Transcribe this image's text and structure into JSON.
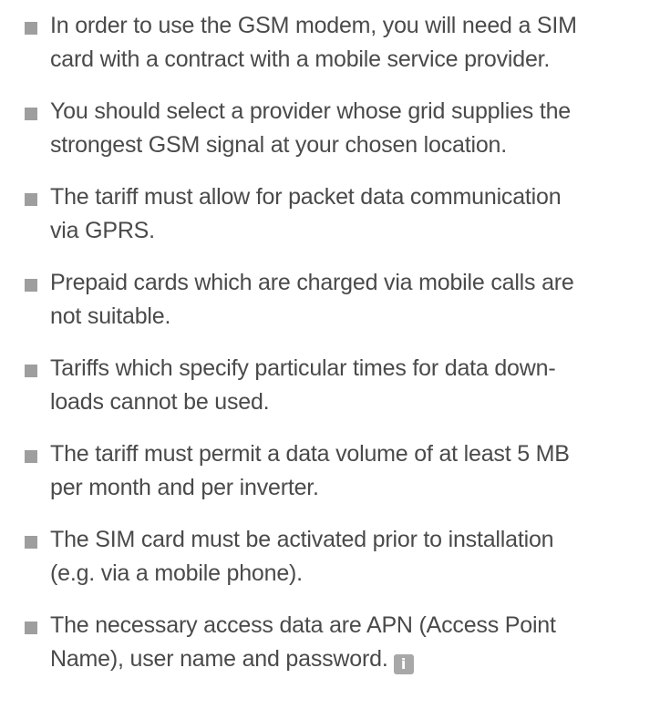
{
  "colors": {
    "bullet": "#9e9e9e",
    "text": "#4a4a4a",
    "info_icon_bg": "#a8a8a8"
  },
  "bullets": [
    {
      "text": "In order to use the GSM modem, you will need a SIM\ncard with a contract with a mobile service provider."
    },
    {
      "text": "You should select a provider whose grid supplies the\nstrongest GSM signal at your chosen location."
    },
    {
      "text": "The tariff must allow for packet data communication\nvia GPRS."
    },
    {
      "text": "Prepaid cards which are charged via mobile calls are\nnot suitable."
    },
    {
      "text": "Tariffs which specify particular times for data down-\nloads cannot be used."
    },
    {
      "text": "The tariff must permit a data volume of at least 5 MB\nper month and per inverter."
    },
    {
      "text": "The SIM card must be activated prior to installation\n(e.g. via a mobile phone)."
    },
    {
      "text": "The necessary access data are APN (Access Point\nName), user name and password."
    }
  ],
  "info_icon": {
    "icon": "info-icon",
    "glyph": "i"
  }
}
